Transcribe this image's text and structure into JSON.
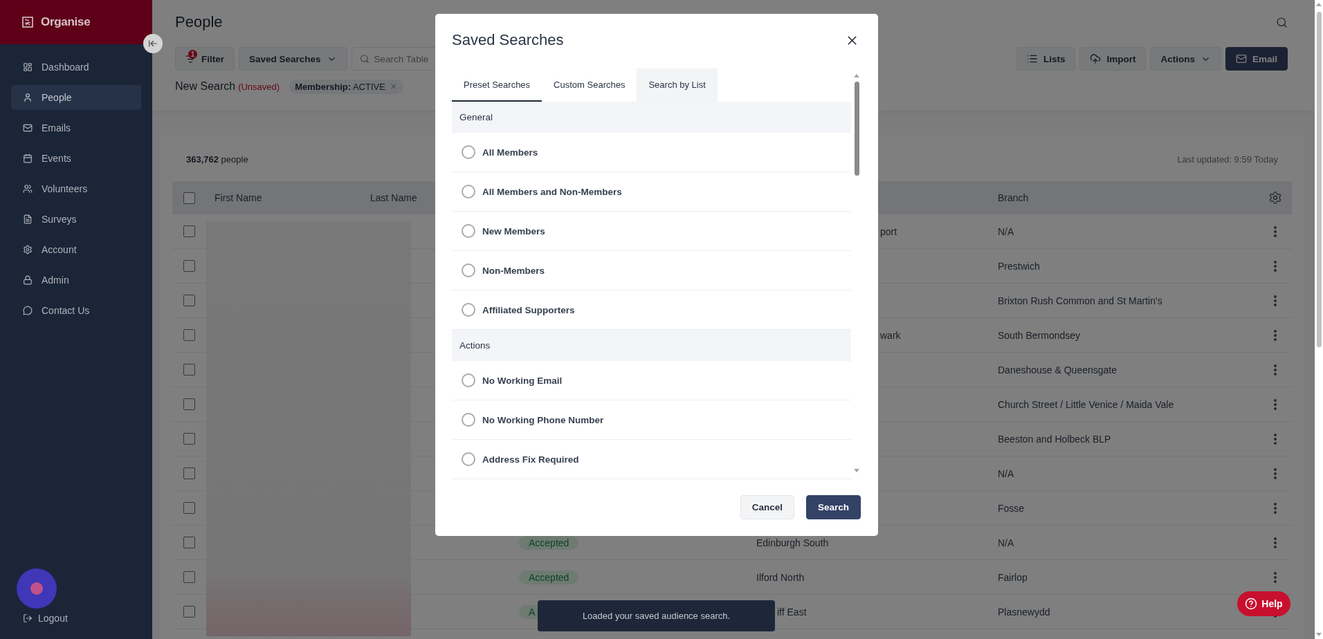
{
  "sidebar": {
    "brand": "Organise",
    "items": [
      {
        "label": "Dashboard",
        "selected": false
      },
      {
        "label": "People",
        "selected": true
      },
      {
        "label": "Emails",
        "selected": false
      },
      {
        "label": "Events",
        "selected": false
      },
      {
        "label": "Volunteers",
        "selected": false
      },
      {
        "label": "Surveys",
        "selected": false
      },
      {
        "label": "Account",
        "selected": false
      },
      {
        "label": "Admin",
        "selected": false
      },
      {
        "label": "Contact Us",
        "selected": false
      }
    ],
    "logout": "Logout"
  },
  "page": {
    "title": "People"
  },
  "toolbar": {
    "filter": {
      "label": "Filter",
      "badge": "1"
    },
    "saved_searches": "Saved Searches",
    "search": {
      "placeholder": "Search Table"
    },
    "actions": [
      {
        "label": "Lists",
        "kind": "plain"
      },
      {
        "label": "Import",
        "kind": "plain"
      },
      {
        "label": "Actions",
        "kind": "dropdown"
      },
      {
        "label": "Email",
        "kind": "primary"
      }
    ]
  },
  "search_query": {
    "title": "New Search",
    "status": "(Unsaved)",
    "chips": [
      "**Membership:** ACTIVE"
    ]
  },
  "table": {
    "count": "**363,762** people",
    "last_updated": "Last updated: 9:59 Today",
    "header_checked": false,
    "header": {
      "first_name": "First Name",
      "last_name": "Last Name",
      "branch": "Branch"
    },
    "rows": [
      {
        "checked": false,
        "column_4": {
          "text": "port",
          "under_dialog": true,
          "under_toast": false
        },
        "branch": "N/A"
      },
      {
        "checked": false,
        "branch": "Prestwich"
      },
      {
        "checked": false,
        "branch": "Brixton Rush Common and St Martin's"
      },
      {
        "checked": false,
        "column_4": {
          "text": "wark",
          "under_dialog": true,
          "under_toast": false
        },
        "branch": "South Bermondsey"
      },
      {
        "checked": false,
        "branch": "Daneshouse & Queensgate"
      },
      {
        "checked": false,
        "branch": "Church Street / Little Venice / Maida Vale"
      },
      {
        "checked": false,
        "branch": "Beeston and Holbeck BLP"
      },
      {
        "checked": false,
        "branch": "N/A"
      },
      {
        "checked": false,
        "branch": "Fosse"
      },
      {
        "checked": false,
        "column_3": {
          "text": "Accepted",
          "under_toast": false
        },
        "column_4": {
          "text": "Edinburgh South",
          "under_dialog": false,
          "under_toast": false
        },
        "branch": "N/A"
      },
      {
        "checked": false,
        "column_3": {
          "text": "Accepted",
          "under_toast": false
        },
        "column_4": {
          "text": "Ilford North",
          "under_dialog": false,
          "under_toast": false
        },
        "branch": "Fairlop"
      },
      {
        "checked": false,
        "column_3": {
          "text": "A",
          "under_toast": true
        },
        "column_4": {
          "text": "iff East",
          "under_dialog": false,
          "under_toast": true
        },
        "branch": "Plasnewydd"
      }
    ]
  },
  "dialog": {
    "title": "Saved Searches",
    "tabs": [
      {
        "label": "Preset Searches",
        "selected": true,
        "hovered": false
      },
      {
        "label": "Custom Searches",
        "selected": false,
        "hovered": false
      },
      {
        "label": "Search by List",
        "selected": false,
        "hovered": true
      }
    ],
    "sections": [
      {
        "title": "General",
        "items": [
          {
            "label": "All Members",
            "selected": false
          },
          {
            "label": "All Members and Non-Members",
            "selected": false
          },
          {
            "label": "New Members",
            "selected": false
          },
          {
            "label": "Non-Members",
            "selected": false
          },
          {
            "label": "Affiliated Supporters",
            "selected": false
          }
        ]
      },
      {
        "title": "Actions",
        "items": [
          {
            "label": "No Working Email",
            "selected": false
          },
          {
            "label": "No Working Phone Number",
            "selected": false
          },
          {
            "label": "Address Fix Required",
            "selected": false
          }
        ]
      }
    ],
    "buttons": [
      {
        "label": "Cancel",
        "kind": "secondary"
      },
      {
        "label": "Search",
        "kind": "primary"
      }
    ]
  },
  "toast": {
    "message": "Loaded your saved audience search."
  },
  "help": {
    "label": "Help"
  }
}
